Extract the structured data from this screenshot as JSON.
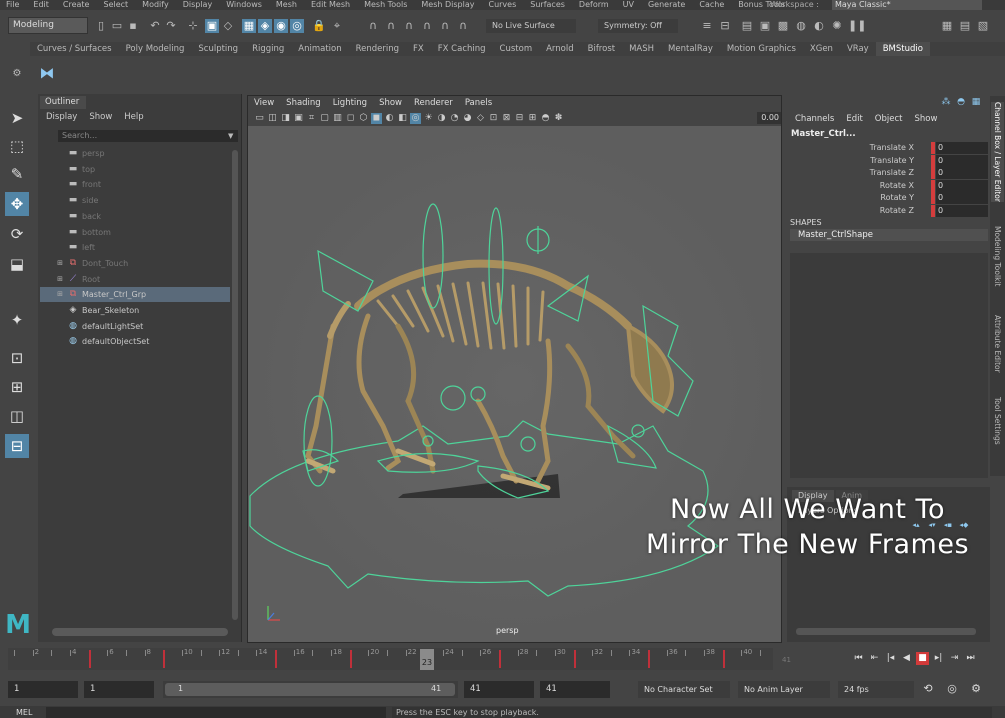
{
  "menu": [
    "File",
    "Edit",
    "Create",
    "Select",
    "Modify",
    "Display",
    "Windows",
    "Mesh",
    "Edit Mesh",
    "Mesh Tools",
    "Mesh Display",
    "Curves",
    "Surfaces",
    "Deform",
    "UV",
    "Generate",
    "Cache",
    "Bonus Tools"
  ],
  "workspace": {
    "label": "Workspace :",
    "value": "Maya Classic*"
  },
  "statusline": {
    "mode": "Modeling",
    "live_surface": "No Live Surface",
    "symmetry": "Symmetry: Off"
  },
  "shelf": {
    "tabs": [
      "Curves / Surfaces",
      "Poly Modeling",
      "Sculpting",
      "Rigging",
      "Animation",
      "Rendering",
      "FX",
      "FX Caching",
      "Custom",
      "Arnold",
      "Bifrost",
      "MASH",
      "MentalRay",
      "Motion Graphics",
      "XGen",
      "VRay",
      "BMStudio"
    ],
    "active": "BMStudio"
  },
  "outliner": {
    "tab": "Outliner",
    "menu": [
      "Display",
      "Show",
      "Help"
    ],
    "search_placeholder": "Search...",
    "items": [
      {
        "label": "persp",
        "icon": "camera-icon",
        "dim": true,
        "expand": ""
      },
      {
        "label": "top",
        "icon": "camera-icon",
        "dim": true,
        "expand": ""
      },
      {
        "label": "front",
        "icon": "camera-icon",
        "dim": true,
        "expand": ""
      },
      {
        "label": "side",
        "icon": "camera-icon",
        "dim": true,
        "expand": ""
      },
      {
        "label": "back",
        "icon": "camera-icon",
        "dim": true,
        "expand": ""
      },
      {
        "label": "bottom",
        "icon": "camera-icon",
        "dim": true,
        "expand": ""
      },
      {
        "label": "left",
        "icon": "camera-icon",
        "dim": true,
        "expand": ""
      },
      {
        "label": "Dont_Touch",
        "icon": "group-icon",
        "dim": true,
        "expand": "⊞"
      },
      {
        "label": "Root",
        "icon": "joint-icon",
        "dim": true,
        "expand": "⊞"
      },
      {
        "label": "Master_Ctrl_Grp",
        "icon": "group-icon",
        "dim": false,
        "expand": "⊞",
        "selected": true
      },
      {
        "label": "Bear_Skeleton",
        "icon": "transform-icon",
        "dim": false,
        "expand": ""
      },
      {
        "label": "defaultLightSet",
        "icon": "set-icon",
        "dim": false,
        "expand": ""
      },
      {
        "label": "defaultObjectSet",
        "icon": "set-icon",
        "dim": false,
        "expand": ""
      }
    ]
  },
  "viewport": {
    "menu": [
      "View",
      "Shading",
      "Lighting",
      "Show",
      "Renderer",
      "Panels"
    ],
    "value": "0.00",
    "camera": "persp",
    "overlay_line1": "Now All We Want To",
    "overlay_line2": "Mirror The New Frames"
  },
  "channelbox": {
    "menu": [
      "Channels",
      "Edit",
      "Object",
      "Show"
    ],
    "object": "Master_Ctrl...",
    "attrs": [
      {
        "label": "Translate X",
        "value": "0"
      },
      {
        "label": "Translate Y",
        "value": "0"
      },
      {
        "label": "Translate Z",
        "value": "0"
      },
      {
        "label": "Rotate X",
        "value": "0"
      },
      {
        "label": "Rotate Y",
        "value": "0"
      },
      {
        "label": "Rotate Z",
        "value": "0"
      }
    ],
    "shapes_header": "SHAPES",
    "shape": "Master_CtrlShape"
  },
  "side_tabs": [
    "Channel Box / Layer Editor",
    "Modeling Toolkit",
    "Attribute Editor",
    "Tool Settings"
  ],
  "layers": {
    "tabs": [
      "Display",
      "Anim"
    ],
    "options": "Layers Options"
  },
  "timeline": {
    "tick_labels": [
      "2",
      "4",
      "6",
      "8",
      "10",
      "12",
      "14",
      "16",
      "18",
      "20",
      "22",
      "24",
      "26",
      "28",
      "30",
      "32",
      "34",
      "36",
      "38",
      "40"
    ],
    "current_frame": "23",
    "end_ghost": "41"
  },
  "range": {
    "start": "1",
    "playback_start": "1",
    "range_start": "1",
    "range_end": "41",
    "playback_end": "41",
    "end": "41",
    "character_set": "No Character Set",
    "anim_layer": "No Anim Layer",
    "fps": "24 fps"
  },
  "cmdline": {
    "lang": "MEL",
    "feedback": "Press the ESC key to stop playback."
  }
}
